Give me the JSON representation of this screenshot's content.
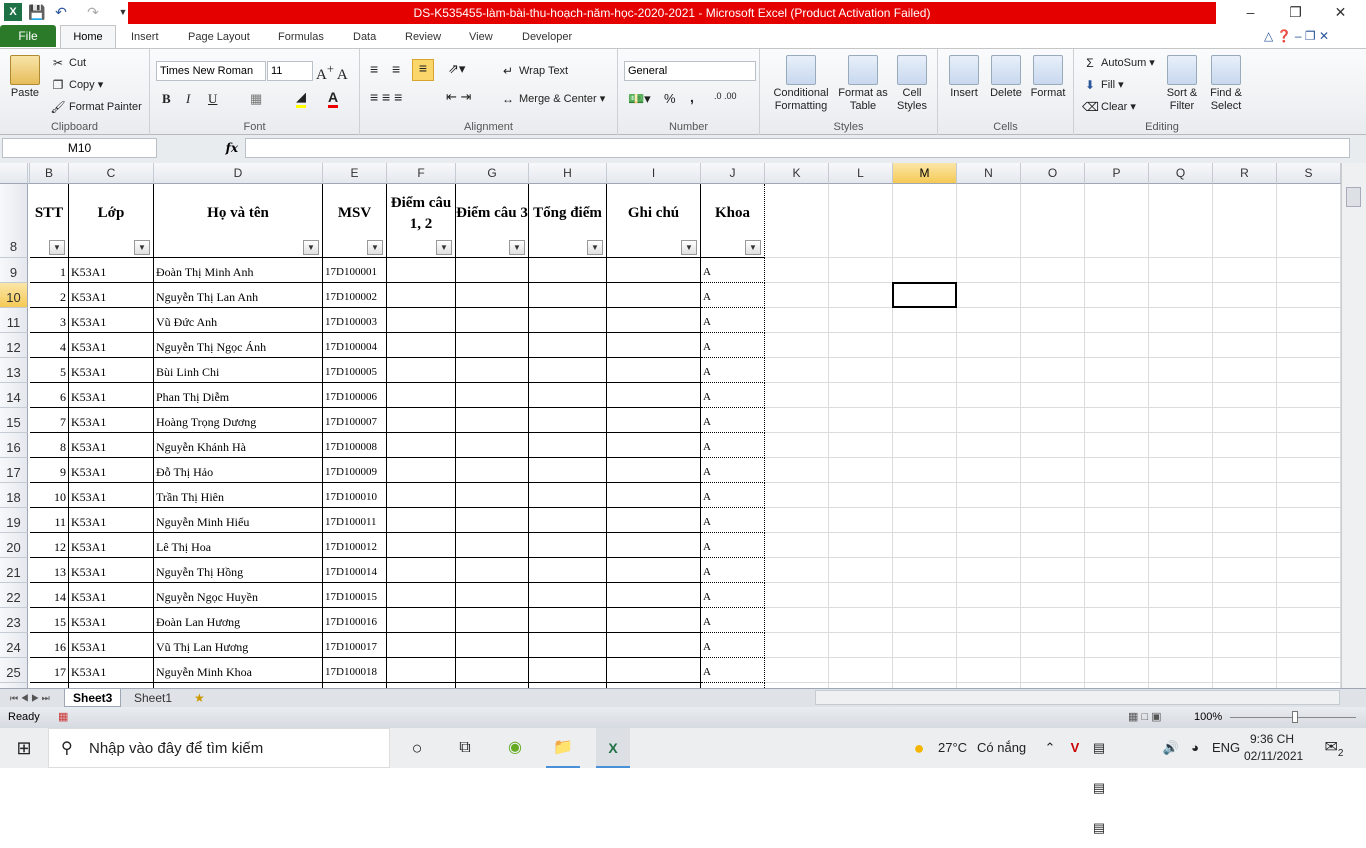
{
  "window": {
    "title": "DS-K535455-làm-bài-thu-hoạch-năm-học-2020-2021 - Microsoft Excel (Product Activation Failed)"
  },
  "tabs": [
    "File",
    "Home",
    "Insert",
    "Page Layout",
    "Formulas",
    "Data",
    "Review",
    "View",
    "Developer"
  ],
  "ribbon": {
    "clipboard": {
      "label": "Clipboard",
      "paste": "Paste",
      "cut": "Cut",
      "copy": "Copy",
      "format_painter": "Format Painter"
    },
    "font": {
      "label": "Font",
      "name": "Times New Roman",
      "size": "11",
      "bold": "B",
      "italic": "I",
      "underline": "U"
    },
    "alignment": {
      "label": "Alignment",
      "wrap": "Wrap Text",
      "merge": "Merge & Center"
    },
    "number": {
      "label": "Number",
      "format": "General",
      "percent": "%",
      "comma": ","
    },
    "styles": {
      "label": "Styles",
      "conditional": "Conditional Formatting",
      "format_table": "Format as Table",
      "cell_styles": "Cell Styles"
    },
    "cells": {
      "label": "Cells",
      "insert": "Insert",
      "delete": "Delete",
      "format": "Format"
    },
    "editing": {
      "label": "Editing",
      "autosum": "AutoSum",
      "fill": "Fill",
      "clear": "Clear",
      "sort": "Sort & Filter",
      "find": "Find & Select"
    }
  },
  "formula_bar": {
    "name_box": "M10",
    "fx": "fx",
    "value": ""
  },
  "columns": [
    "B",
    "C",
    "D",
    "E",
    "F",
    "G",
    "H",
    "I",
    "J",
    "K",
    "L",
    "M",
    "N",
    "O",
    "P",
    "Q",
    "R",
    "S"
  ],
  "selected_column": "M",
  "selected_row": "10",
  "header_row": {
    "row": "8",
    "cells": [
      "STT",
      "Lớp",
      "Họ và tên",
      "MSV",
      "Điểm câu 1, 2",
      "Điểm câu 3",
      "Tổng điểm",
      "Ghi chú",
      "Khoa"
    ]
  },
  "rows": [
    {
      "row": "9",
      "stt": "1",
      "lop": "K53A1",
      "name": "Đoàn Thị Minh Anh",
      "msv": "17D100001",
      "khoa": "A"
    },
    {
      "row": "10",
      "stt": "2",
      "lop": "K53A1",
      "name": "Nguyễn Thị Lan Anh",
      "msv": "17D100002",
      "khoa": "A"
    },
    {
      "row": "11",
      "stt": "3",
      "lop": "K53A1",
      "name": "Vũ Đức Anh",
      "msv": "17D100003",
      "khoa": "A"
    },
    {
      "row": "12",
      "stt": "4",
      "lop": "K53A1",
      "name": "Nguyễn Thị Ngọc Ánh",
      "msv": "17D100004",
      "khoa": "A"
    },
    {
      "row": "13",
      "stt": "5",
      "lop": "K53A1",
      "name": "Bùi Linh Chi",
      "msv": "17D100005",
      "khoa": "A"
    },
    {
      "row": "14",
      "stt": "6",
      "lop": "K53A1",
      "name": "Phan Thị Diễm",
      "msv": "17D100006",
      "khoa": "A"
    },
    {
      "row": "15",
      "stt": "7",
      "lop": "K53A1",
      "name": "Hoàng Trọng Dương",
      "msv": "17D100007",
      "khoa": "A"
    },
    {
      "row": "16",
      "stt": "8",
      "lop": "K53A1",
      "name": "Nguyễn Khánh Hà",
      "msv": "17D100008",
      "khoa": "A"
    },
    {
      "row": "17",
      "stt": "9",
      "lop": "K53A1",
      "name": "Đỗ Thị Hảo",
      "msv": "17D100009",
      "khoa": "A"
    },
    {
      "row": "18",
      "stt": "10",
      "lop": "K53A1",
      "name": "Trần Thị Hiên",
      "msv": "17D100010",
      "khoa": "A"
    },
    {
      "row": "19",
      "stt": "11",
      "lop": "K53A1",
      "name": "Nguyễn Minh Hiếu",
      "msv": "17D100011",
      "khoa": "A"
    },
    {
      "row": "20",
      "stt": "12",
      "lop": "K53A1",
      "name": "Lê Thị Hoa",
      "msv": "17D100012",
      "khoa": "A"
    },
    {
      "row": "21",
      "stt": "13",
      "lop": "K53A1",
      "name": "Nguyễn Thị Hồng",
      "msv": "17D100014",
      "khoa": "A"
    },
    {
      "row": "22",
      "stt": "14",
      "lop": "K53A1",
      "name": "Nguyễn Ngọc Huyền",
      "msv": "17D100015",
      "khoa": "A"
    },
    {
      "row": "23",
      "stt": "15",
      "lop": "K53A1",
      "name": "Đoàn Lan Hương",
      "msv": "17D100016",
      "khoa": "A"
    },
    {
      "row": "24",
      "stt": "16",
      "lop": "K53A1",
      "name": "Vũ Thị Lan Hương",
      "msv": "17D100017",
      "khoa": "A"
    },
    {
      "row": "25",
      "stt": "17",
      "lop": "K53A1",
      "name": "Nguyễn Minh Khoa",
      "msv": "17D100018",
      "khoa": "A"
    }
  ],
  "sheets": [
    "Sheet3",
    "Sheet1"
  ],
  "status": {
    "ready": "Ready",
    "zoom": "100%"
  },
  "taskbar": {
    "search_placeholder": "Nhập vào đây để tìm kiếm",
    "temp": "27°C",
    "weather": "Có nắng",
    "lang": "ENG",
    "time": "9:36 CH",
    "date": "02/11/2021",
    "notifications": "2"
  }
}
